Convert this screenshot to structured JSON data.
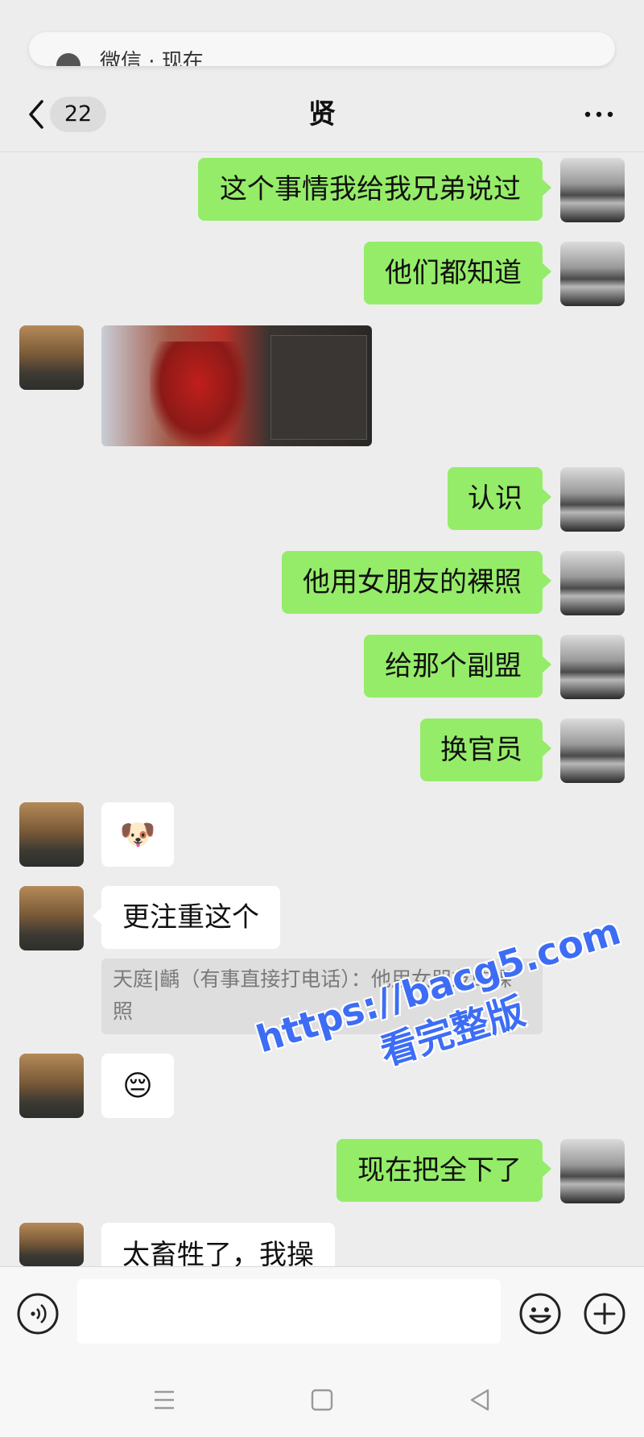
{
  "notification": {
    "text": "微信 · 现在"
  },
  "header": {
    "unread_count": "22",
    "title": "贤"
  },
  "messages": [
    {
      "dir": "out",
      "type": "text",
      "text": "这个事情我给我兄弟说过"
    },
    {
      "dir": "out",
      "type": "text",
      "text": "他们都知道"
    },
    {
      "dir": "in",
      "type": "image"
    },
    {
      "dir": "out",
      "type": "text",
      "text": "认识"
    },
    {
      "dir": "out",
      "type": "text",
      "text": "他用女朋友的裸照"
    },
    {
      "dir": "out",
      "type": "text",
      "text": "给那个副盟"
    },
    {
      "dir": "out",
      "type": "text",
      "text": "换官员"
    },
    {
      "dir": "in",
      "type": "sticker",
      "emoji": "🐶"
    },
    {
      "dir": "in",
      "type": "text",
      "text": "更注重这个",
      "quote": "天庭|齲（有事直接打电话）：他用女朋友的裸照"
    },
    {
      "dir": "in",
      "type": "sticker",
      "emoji": "😔"
    },
    {
      "dir": "out",
      "type": "text",
      "text": "现在把全下了"
    },
    {
      "dir": "in",
      "type": "text",
      "text": "太畜牲了，我操"
    }
  ],
  "watermark": {
    "line1": "https://bacg5.com",
    "line2": "看完整版"
  },
  "input": {
    "placeholder": ""
  },
  "icons": {
    "back": "back-arrow-icon",
    "more": "more-dots-icon",
    "voice": "voice-icon",
    "emoji": "emoji-icon",
    "plus": "plus-icon"
  },
  "colors": {
    "outgoing_bubble": "#95ec69",
    "incoming_bubble": "#ffffff",
    "background": "#ededed",
    "watermark": "#3d6df5"
  }
}
